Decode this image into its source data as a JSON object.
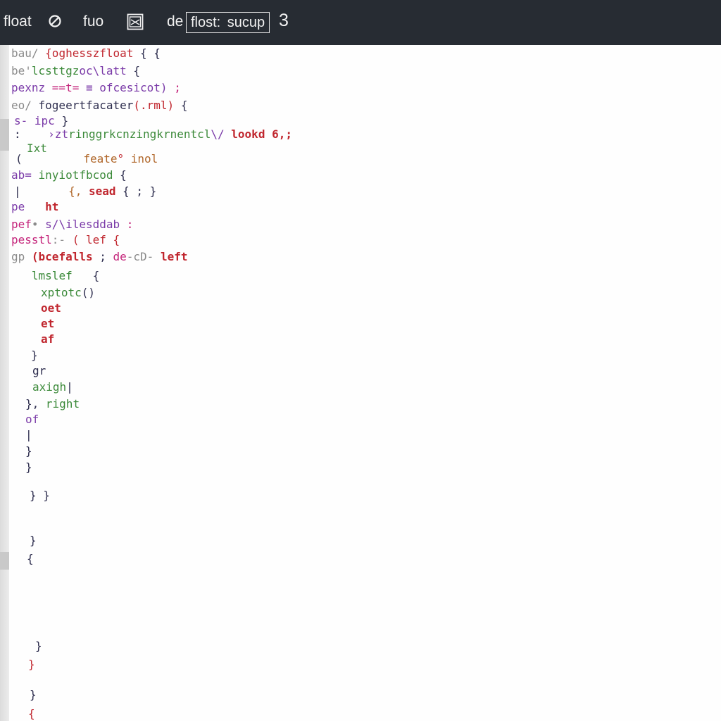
{
  "toolbar": {
    "title": "float",
    "tab_fuo": "fuo",
    "label_de": "de",
    "field_value": "flost:  sucup",
    "number": "3",
    "null_icon": "null-circle-icon",
    "box_icon": "boxed-window-icon"
  },
  "colors": {
    "toolbar_bg": "#272c33",
    "editor_bg": "#fefefe",
    "red": "#c0262e",
    "green": "#3c8a3a",
    "purple": "#7a3aa8",
    "magenta": "#c4237a",
    "navy": "#2d2d4e",
    "brown": "#b0672a",
    "gray": "#8a8a8a"
  },
  "code": {
    "lines": [
      {
        "segs": [
          {
            "t": "bau/ ",
            "c": "gray"
          },
          {
            "t": "{oghessz",
            "c": "red"
          },
          {
            "t": "float ",
            "c": "red"
          },
          {
            "t": "{ {",
            "c": "navy"
          }
        ]
      },
      {
        "segs": [
          {
            "t": "be'",
            "c": "gray"
          },
          {
            "t": "lcsttgz",
            "c": "green"
          },
          {
            "t": "oc\\latt ",
            "c": "purple"
          },
          {
            "t": "{",
            "c": "navy"
          }
        ]
      },
      {
        "segs": [
          {
            "t": "pexnz ",
            "c": "purple"
          },
          {
            "t": "==t= ",
            "c": "magenta"
          },
          {
            "t": "≡ ",
            "c": "purple"
          },
          {
            "t": "ofcesicot) ",
            "c": "purple"
          },
          {
            "t": ";",
            "c": "magenta"
          }
        ]
      },
      {
        "segs": [
          {
            "t": "eo/ ",
            "c": "gray"
          },
          {
            "t": "fogeertfacater",
            "c": "navy"
          },
          {
            "t": "(.rml) ",
            "c": "red"
          },
          {
            "t": "{",
            "c": "navy"
          }
        ]
      },
      {
        "segs": [
          {
            "t": "s- ipc ",
            "c": "purple"
          },
          {
            "t": "}",
            "c": "navy"
          }
        ]
      },
      {
        "segs": [
          {
            "t": ":    ",
            "c": "navy"
          },
          {
            "t": "›zt",
            "c": "purple"
          },
          {
            "t": "ringgrkcnzingkrnentcl",
            "c": "green"
          },
          {
            "t": "\\/ ",
            "c": "purple"
          },
          {
            "t": "lookd 6,;",
            "c": "red"
          }
        ]
      },
      {
        "segs": [
          {
            "t": "Ixt",
            "c": "green"
          }
        ]
      },
      {
        "segs": [
          {
            "t": "(         ",
            "c": "navy"
          },
          {
            "t": "feate",
            "c": "brown"
          },
          {
            "t": "° ",
            "c": "red"
          },
          {
            "t": "inol",
            "c": "brown"
          }
        ]
      },
      {
        "segs": [
          {
            "t": "ab= ",
            "c": "purple"
          },
          {
            "t": "inyiotfbcod ",
            "c": "green"
          },
          {
            "t": "{",
            "c": "navy"
          }
        ]
      },
      {
        "segs": [
          {
            "t": "|       ",
            "c": "navy"
          },
          {
            "t": "{, ",
            "c": "brown"
          },
          {
            "t": "sead ",
            "c": "red"
          },
          {
            "t": "{ ; }",
            "c": "navy"
          }
        ]
      },
      {
        "segs": [
          {
            "t": "pe   ",
            "c": "purple"
          },
          {
            "t": "ht",
            "c": "red"
          }
        ]
      },
      {
        "segs": [
          {
            "t": "pef",
            "c": "magenta"
          },
          {
            "t": "• ",
            "c": "gray"
          },
          {
            "t": "s/\\ilesddab ",
            "c": "purple"
          },
          {
            "t": ":",
            "c": "magenta"
          }
        ]
      },
      {
        "segs": [
          {
            "t": "pesstl",
            "c": "magenta"
          },
          {
            "t": ":- ",
            "c": "gray"
          },
          {
            "t": "( lef {",
            "c": "red"
          }
        ]
      },
      {
        "segs": [
          {
            "t": "gp ",
            "c": "gray"
          },
          {
            "t": "(bcefalls ",
            "c": "red"
          },
          {
            "t": "; ",
            "c": "navy"
          },
          {
            "t": "de",
            "c": "magenta"
          },
          {
            "t": "-cD- ",
            "c": "gray"
          },
          {
            "t": "left",
            "c": "red"
          }
        ]
      },
      {
        "segs": [
          {
            "t": "   ",
            "c": "gray"
          },
          {
            "t": "lmslef ",
            "c": "green"
          },
          {
            "t": "  {",
            "c": "navy"
          }
        ]
      },
      {
        "segs": [
          {
            "t": "xptotc",
            "c": "green"
          },
          {
            "t": "()",
            "c": "navy"
          }
        ]
      },
      {
        "segs": [
          {
            "t": "oet",
            "c": "red"
          }
        ]
      },
      {
        "segs": [
          {
            "t": "et",
            "c": "red"
          }
        ]
      },
      {
        "segs": [
          {
            "t": "af",
            "c": "red"
          }
        ]
      },
      {
        "segs": [
          {
            "t": "}",
            "c": "navy"
          }
        ]
      },
      {
        "segs": [
          {
            "t": "gr",
            "c": "navy"
          }
        ]
      },
      {
        "segs": [
          {
            "t": "axigh",
            "c": "green"
          },
          {
            "t": "|",
            "c": "navy"
          }
        ]
      },
      {
        "segs": [
          {
            "t": "}, ",
            "c": "navy"
          },
          {
            "t": "right",
            "c": "green"
          }
        ]
      },
      {
        "segs": [
          {
            "t": "of",
            "c": "purple"
          }
        ]
      },
      {
        "segs": [
          {
            "t": "|",
            "c": "navy"
          }
        ]
      },
      {
        "segs": [
          {
            "t": "}",
            "c": "navy"
          }
        ]
      },
      {
        "segs": [
          {
            "t": "}",
            "c": "navy"
          }
        ]
      },
      {
        "segs": [
          {
            "t": "} }",
            "c": "navy"
          }
        ]
      },
      {
        "segs": [
          {
            "t": "}",
            "c": "navy"
          }
        ]
      },
      {
        "segs": [
          {
            "t": "{",
            "c": "navy"
          }
        ]
      },
      {
        "segs": [
          {
            "t": "}",
            "c": "navy"
          }
        ]
      },
      {
        "segs": [
          {
            "t": "}",
            "c": "red"
          }
        ]
      },
      {
        "segs": [
          {
            "t": "}",
            "c": "navy"
          }
        ]
      },
      {
        "segs": [
          {
            "t": "{",
            "c": "red"
          }
        ]
      }
    ]
  }
}
